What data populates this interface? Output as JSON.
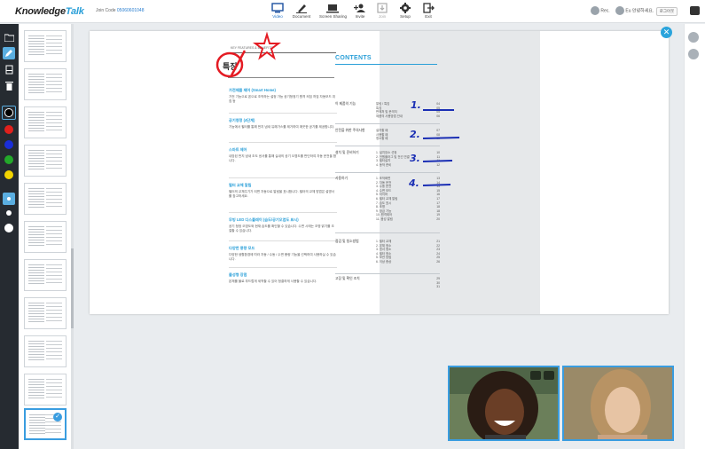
{
  "app": {
    "logo_part1": "Knowledge",
    "logo_part2": "Talk",
    "join_label": "Join Code",
    "join_code": "05060601048"
  },
  "toolbar": {
    "items": [
      {
        "label": "Video",
        "icon": "monitor-icon"
      },
      {
        "label": "Document",
        "icon": "pen-icon"
      },
      {
        "label": "Screen Sharing",
        "icon": "laptop-icon"
      },
      {
        "label": "Invite",
        "icon": "add-person-icon"
      },
      {
        "label": "Join",
        "icon": "join-icon"
      },
      {
        "label": "Setup",
        "icon": "gear-icon"
      },
      {
        "label": "Exit",
        "icon": "exit-icon"
      }
    ],
    "rec_label": "Rec.",
    "user_label": "Eu 안녕하세요.",
    "logout_label": "로그아웃"
  },
  "left_tools": {
    "colors": [
      "#000000",
      "#e0201c",
      "#1a2ed8",
      "#23a82a",
      "#f3d400"
    ],
    "sizes": [
      "small",
      "medium",
      "large"
    ]
  },
  "document": {
    "header_small": "KEY FEATURES & BENEFITS",
    "title": "특징",
    "features": [
      {
        "heading": "가전제품 제어 (Smart Home)",
        "body": "가전 기능으로 폰으로 조작하는 설정 가능 공기청정기 원격 켜짐 꺼짐 자동모드 취침 등"
      },
      {
        "heading": "공기청정 (4단계)",
        "body": "기능에서 필터를 통해 먼지 냄새 유해가스를 제거하여 깨끗한 공기를 제공합니다."
      },
      {
        "heading": "스마트 제어",
        "body": "내장된 먼지 냄새 조도 센서를 통해 실내의 공기 오염도를 판단하여 자동 운전을 합니다."
      },
      {
        "heading": "필터 교체 알림",
        "body": "필터의 교체주기가 되면 자동으로 알림을 표시합니다. 필터의 교체 방법은 설명서를 참고하세요."
      },
      {
        "heading": "무빙 LED 디스플레이 (습도/공기오염도 표시)",
        "body": "공기 청정 오염도와 현재 습도를 확인할 수 있습니다. 수면 시에는 조명 밝기를 조절할 수 있습니다."
      },
      {
        "heading": "다양한 풍량 모드",
        "body": "다양한 생활환경에 따라 자동 / 수동 / 수면 풍량 기능을 선택하여 사용하실 수 있습니다."
      },
      {
        "heading": "물성형 장점",
        "body": "본체를 물로 부드럽게 세척할 수 있어 청결하게 사용할 수 있습니다."
      }
    ],
    "contents_title": "CONTENTS",
    "toc": [
      {
        "title": "이 제품의 기능",
        "items": [
          [
            "알림 / 특징",
            "04"
          ],
          [
            "특징",
            "05"
          ],
          [
            "판매처 및 문의처",
            "05"
          ],
          [
            "제품의 사용방법 안내",
            "06"
          ]
        ]
      },
      {
        "title": "안전을 위한 주의사항",
        "items": [
          [
            "설치할 때",
            "07"
          ],
          [
            "사용할 때",
            "08"
          ],
          [
            "청소할 때",
            "09"
          ]
        ]
      },
      {
        "title": "설치 및 준비하기",
        "items": [
          [
            "1. 설치장소 선정",
            "10"
          ],
          [
            "2. 전원플러그 및 전선 연결",
            "11"
          ],
          [
            "3. 필터설치",
            "11"
          ],
          [
            "4. 동작 준비",
            "12"
          ]
        ]
      },
      {
        "title": "사용하기",
        "items": [
          [
            "1. 조작화면",
            "13"
          ],
          [
            "2. 자동 운전",
            "14"
          ],
          [
            "3. 수동 운전",
            "15"
          ],
          [
            "4. 수면 모드",
            "15"
          ],
          [
            "5. 타이머",
            "16"
          ],
          [
            "6. 필터 교체 알림",
            "17"
          ],
          [
            "7. 습도 표시",
            "17"
          ],
          [
            "8. 조명",
            "18"
          ],
          [
            "9. 잠금 기능",
            "18"
          ],
          [
            "10. 원격제어",
            "19"
          ],
          [
            "11. 음성 알림",
            "20"
          ]
        ]
      },
      {
        "title": "점검 및 청소방법",
        "items": [
          [
            "1. 필터 교체",
            "21"
          ],
          [
            "2. 본체 청소",
            "22"
          ],
          [
            "3. 센서 청소",
            "23"
          ],
          [
            "4. 필터 청소",
            "24"
          ],
          [
            "5. 보관 방법",
            "25"
          ],
          [
            "6. 이상 증상",
            "26"
          ]
        ]
      },
      {
        "title": "고장 및 확인 조치",
        "items": [
          [
            "",
            "29"
          ],
          [
            "",
            "30"
          ],
          [
            "",
            "31"
          ]
        ]
      }
    ],
    "annotations": [
      "1.",
      "2.",
      "3.",
      "4."
    ]
  },
  "colors": {
    "accent": "#2a9fd8",
    "dark_strip": "#262b31",
    "annotation_blue": "#1a2eb4",
    "annotation_red": "#e41b23"
  }
}
